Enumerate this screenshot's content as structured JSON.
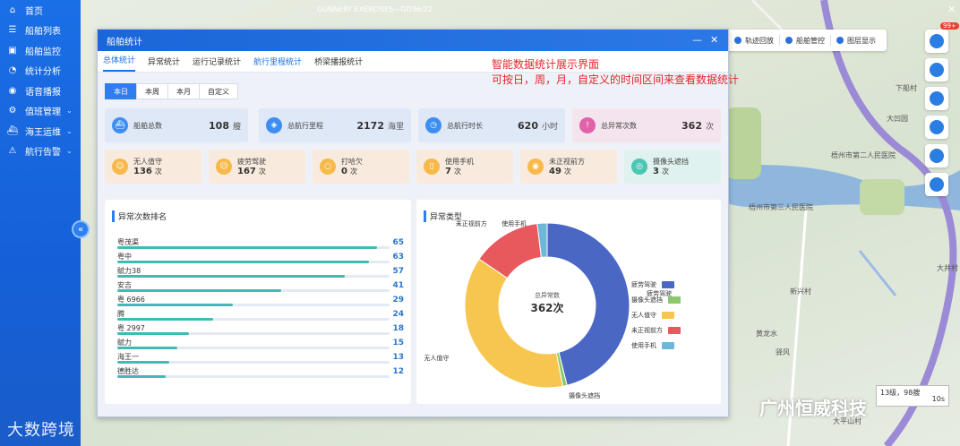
{
  "window": {
    "title": "GUNNERY EXERCISES—GD36/22",
    "close_symbol": "✕"
  },
  "sidebar": {
    "items": [
      {
        "label": "首页",
        "icon": "home-icon"
      },
      {
        "label": "船舶列表",
        "icon": "list-icon"
      },
      {
        "label": "船舶监控",
        "icon": "monitor-icon"
      },
      {
        "label": "统计分析",
        "icon": "chart-icon"
      },
      {
        "label": "语音播报",
        "icon": "speaker-icon"
      },
      {
        "label": "值班管理",
        "icon": "gear-icon",
        "caret": "⌄"
      },
      {
        "label": "海王运维",
        "icon": "ship-icon",
        "caret": "⌄"
      },
      {
        "label": "航行告警",
        "icon": "alarm-icon",
        "caret": "⌄"
      }
    ],
    "collapse_symbol": "«",
    "brand": "大数跨境"
  },
  "toolbar": {
    "items": [
      "轨迹回放",
      "船舶管控",
      "图层显示"
    ],
    "badge": "99+"
  },
  "map": {
    "places": [
      {
        "name": "梧州市第二人民医院"
      },
      {
        "name": "梧州市第三人民医院"
      },
      {
        "name": "下船村"
      },
      {
        "name": "大凹园"
      },
      {
        "name": "新兴村"
      },
      {
        "name": "大平山村"
      },
      {
        "name": "大井村"
      },
      {
        "name": "驿风"
      },
      {
        "name": "黄龙水"
      }
    ],
    "scale_text": "13级，98艘",
    "scale_time": "10s",
    "watermark": "广州恒威科技"
  },
  "dialog": {
    "title": "船舶统计",
    "minimize": "—",
    "close": "✕",
    "tabs": [
      {
        "label": "总体统计",
        "active": true
      },
      {
        "label": "异常统计"
      },
      {
        "label": "运行记录统计"
      },
      {
        "label": "航行里程统计",
        "highlight": true
      },
      {
        "label": "桥梁播报统计"
      }
    ],
    "annotation_line1": "智能数据统计展示界面",
    "annotation_line2": "可按日，周，月，自定义的时间区间来查看数据统计",
    "periods": [
      {
        "label": "本日",
        "active": true
      },
      {
        "label": "本周"
      },
      {
        "label": "本月"
      },
      {
        "label": "自定义"
      }
    ],
    "summary": [
      {
        "label": "船舶总数",
        "value": "108",
        "unit": "艘",
        "color": "#3c8ef3"
      },
      {
        "label": "总航行里程",
        "value": "2172",
        "unit": "海里",
        "color": "#3c8ef3"
      },
      {
        "label": "总航行时长",
        "value": "620",
        "unit": "小时",
        "color": "#3c8ef3"
      },
      {
        "label": "总异常次数",
        "value": "362",
        "unit": "次",
        "color": "#e062a8"
      }
    ],
    "alarms": [
      {
        "label": "无人值守",
        "value": "136",
        "unit": "次"
      },
      {
        "label": "疲劳驾驶",
        "value": "167",
        "unit": "次"
      },
      {
        "label": "打哈欠",
        "value": "0",
        "unit": "次"
      },
      {
        "label": "使用手机",
        "value": "7",
        "unit": "次"
      },
      {
        "label": "未正视前方",
        "value": "49",
        "unit": "次"
      },
      {
        "label": "摄像头遮挡",
        "value": "3",
        "unit": "次"
      }
    ],
    "ranking": {
      "title": "异常次数排名",
      "max": 65,
      "rows": [
        {
          "name": "粤茂渠",
          "value": 65
        },
        {
          "name": "粤中",
          "value": 63
        },
        {
          "name": "赋力38",
          "value": 57
        },
        {
          "name": "安吉",
          "value": 41
        },
        {
          "name": "粤   6966",
          "value": 29
        },
        {
          "name": "腾",
          "value": 24
        },
        {
          "name": "粤   2997",
          "value": 18
        },
        {
          "name": "赋力",
          "value": 15
        },
        {
          "name": "海王一",
          "value": 13
        },
        {
          "name": "德胜达",
          "value": 12
        }
      ]
    },
    "pie": {
      "title": "异常类型",
      "center_label": "总异常数",
      "center_value": "362次"
    }
  },
  "chart_data": {
    "type": "pie",
    "title": "异常类型",
    "donut": true,
    "center_label": "总异常数",
    "center_value": "362次",
    "labels": [
      "疲劳驾驶",
      "摄像头遮挡",
      "无人值守",
      "未正视前方",
      "使用手机"
    ],
    "values": [
      167,
      3,
      136,
      49,
      7
    ],
    "colors": [
      "#4a67c4",
      "#8bc86a",
      "#f7c64f",
      "#e8595e",
      "#6eb7d9"
    ],
    "legend_position": "right"
  }
}
